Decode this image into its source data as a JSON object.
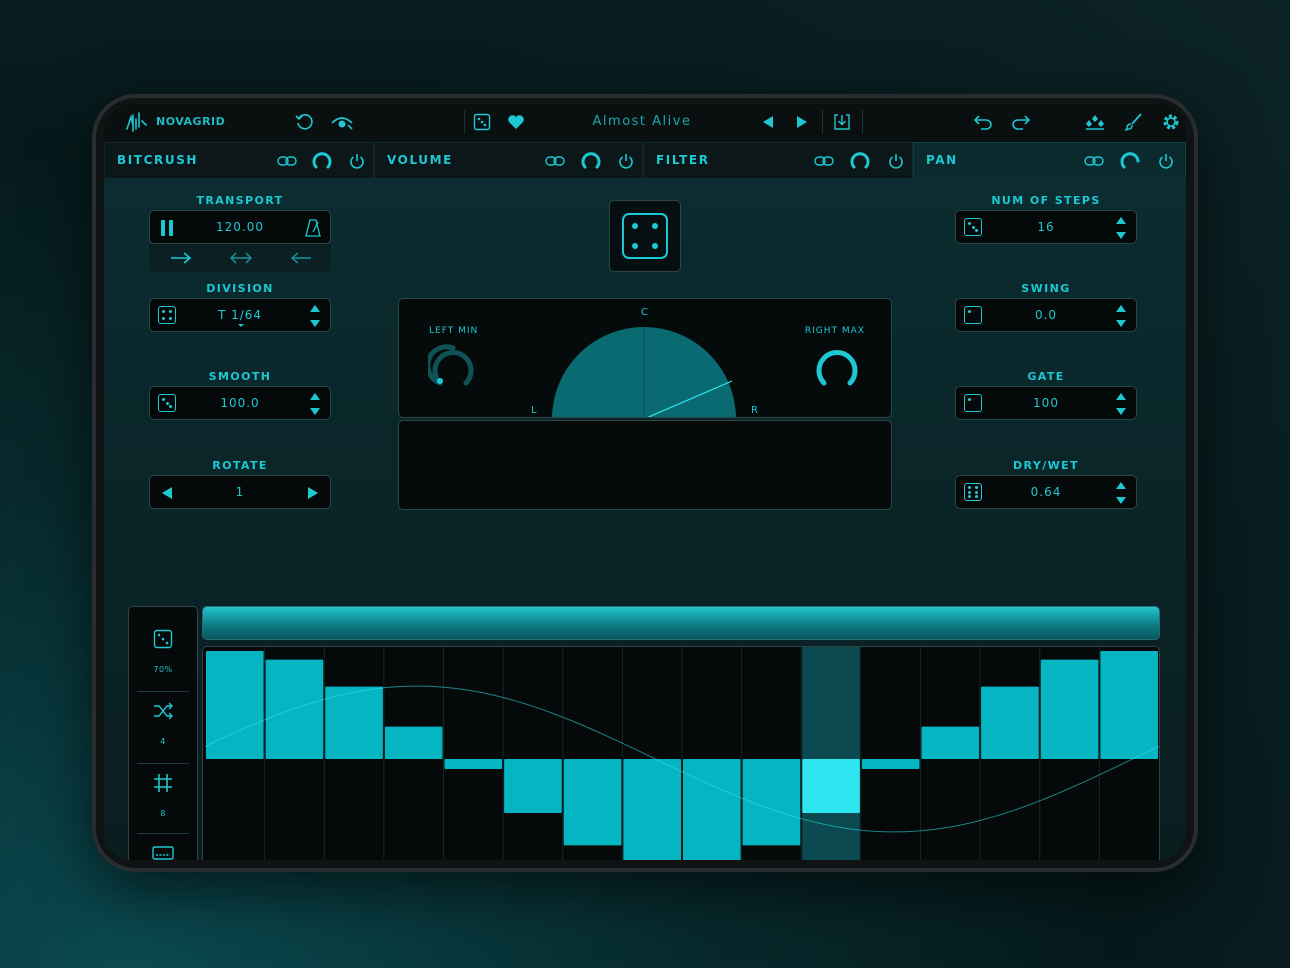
{
  "app": {
    "name": "NOVAGRID"
  },
  "header": {
    "preset_name": "Almost Alive"
  },
  "tabs": [
    {
      "label": "BITCRUSH",
      "active": false
    },
    {
      "label": "VOLUME",
      "active": false
    },
    {
      "label": "FILTER",
      "active": false
    },
    {
      "label": "PAN",
      "active": true
    }
  ],
  "transport": {
    "title": "TRANSPORT",
    "bpm": "120.00",
    "state": "playing"
  },
  "division": {
    "title": "DIVISION",
    "value": "T 1/64"
  },
  "smooth": {
    "title": "SMOOTH",
    "value": "100.0"
  },
  "rotate": {
    "title": "ROTATE",
    "value": "1"
  },
  "num_steps": {
    "title": "NUM OF STEPS",
    "value": "16"
  },
  "swing": {
    "title": "SWING",
    "value": "0.0"
  },
  "gate": {
    "title": "GATE",
    "value": "100"
  },
  "dry_wet": {
    "title": "DRY/WET",
    "value": "0.64"
  },
  "pan": {
    "left_min_label": "LEFT MIN",
    "right_max_label": "RIGHT MAX",
    "center_label": "C",
    "left_label": "L",
    "right_label": "R"
  },
  "sidebar": {
    "random_value": "70%",
    "shuffle_value": "4",
    "grid_value": "8"
  },
  "steps": {
    "values": [
      1.0,
      0.92,
      0.67,
      0.3,
      -0.1,
      -0.5,
      -0.8,
      -0.97,
      -0.97,
      -0.8,
      -0.5,
      -0.1,
      0.3,
      0.67,
      0.92,
      1.0
    ],
    "current_step": 10
  },
  "colors": {
    "accent": "#1ec8d3",
    "bar": "#06b5c2",
    "bar_active": "#2ee6f0",
    "background": "#0a2326"
  },
  "shape_selected_index": 13
}
